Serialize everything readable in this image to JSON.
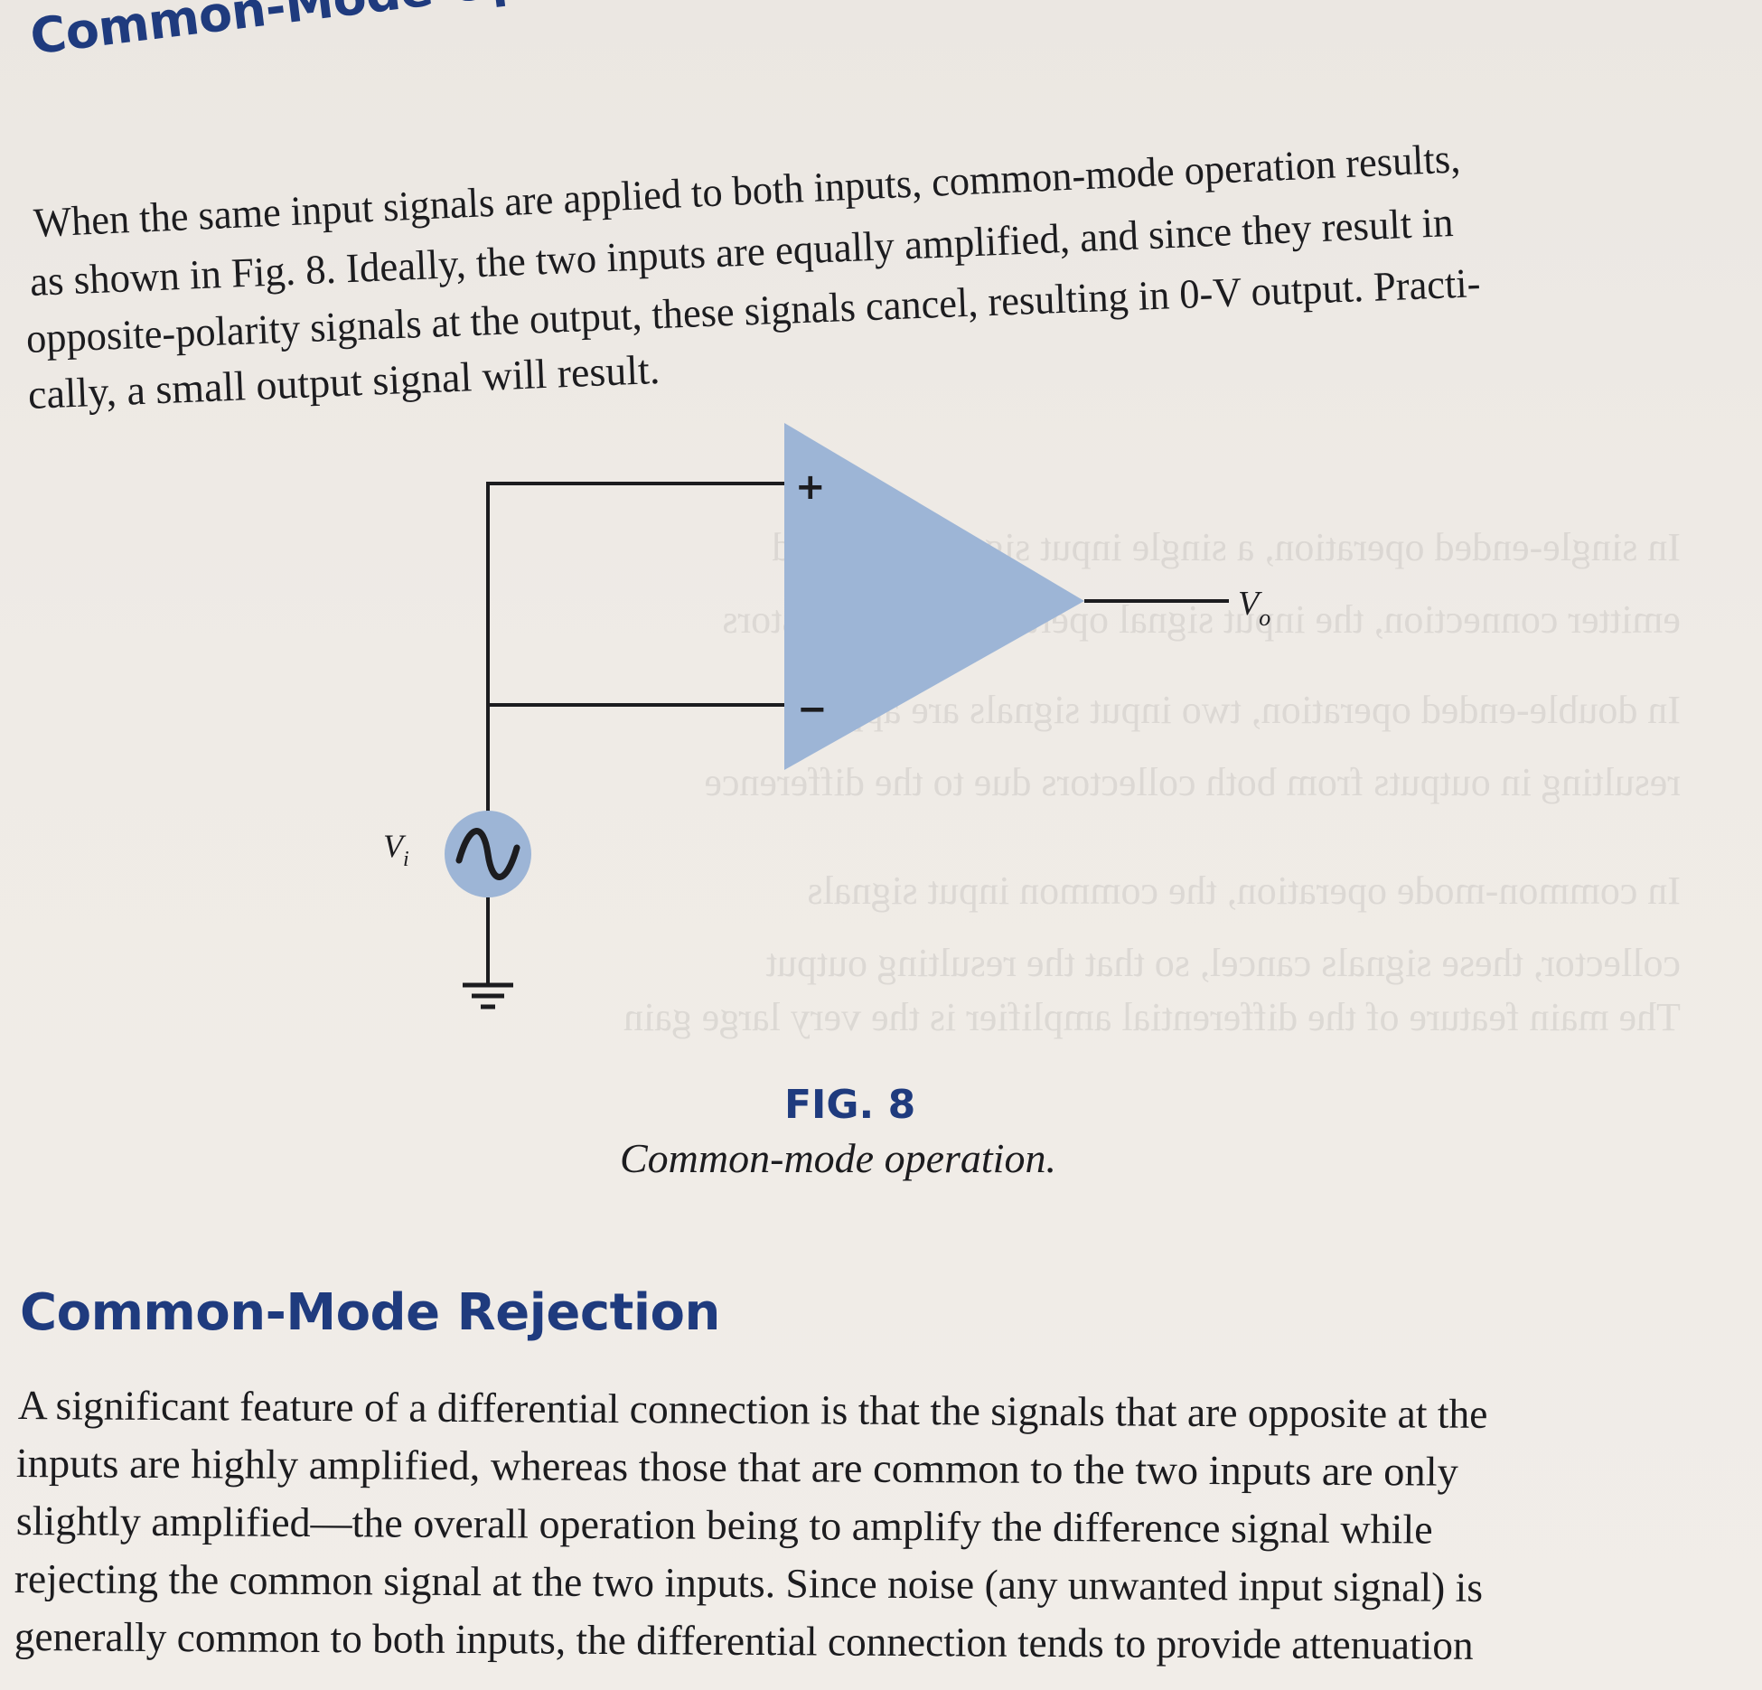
{
  "section1": {
    "heading": "Common-Mode Operation",
    "lines": [
      "When the same input signals are applied to both inputs, common-mode operation results,",
      "as shown in Fig. 8. Ideally, the two inputs are equally amplified, and since they result in",
      "opposite-polarity signals at the output, these signals cancel, resulting in 0-V output. Practi-",
      "cally, a small output signal will result."
    ]
  },
  "figure": {
    "plus_label": "+",
    "minus_label": "−",
    "input_label": "V",
    "input_sub": "i",
    "output_label": "V",
    "output_sub": "o",
    "caption_label": "FIG. 8",
    "caption_text": "Common-mode operation.",
    "colors": {
      "amplifier_fill": "#9db5d6",
      "source_fill": "#9db5d6",
      "wire": "#1c1c1f",
      "accent": "#1f3b7e"
    }
  },
  "section2": {
    "heading": "Common-Mode Rejection",
    "lines": [
      "A significant feature of a differential connection is that the signals that are opposite at the",
      "inputs are highly amplified, whereas those that are common to the two inputs are only",
      "slightly amplified—the overall operation being to amplify the difference signal while",
      "rejecting the common signal at the two inputs. Since noise (any unwanted input signal) is",
      "generally common to both inputs, the differential connection tends to provide attenuation"
    ]
  }
}
